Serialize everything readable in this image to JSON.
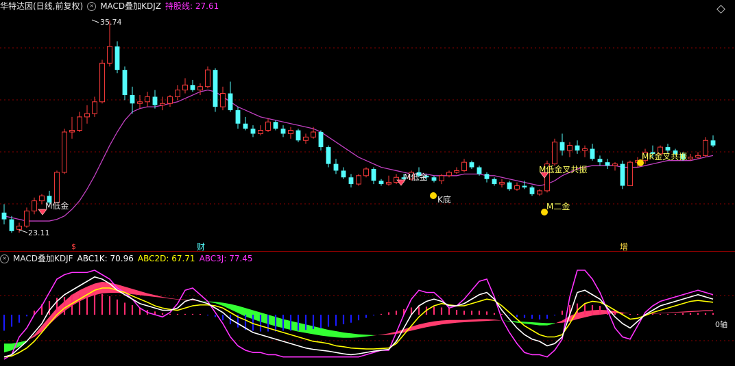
{
  "header_main": {
    "title": "华特达因(日线,前复权)",
    "indicator_name": "MACD叠加KDJZ",
    "hold_label": "持股线: 27.61",
    "colors": {
      "title": "#e6e6e6",
      "indicator": "#e6e6e6",
      "hold": "#ff33ff"
    }
  },
  "header_sub": {
    "indicator_name": "MACD叠加KDJF",
    "abc1k": "ABC1K: 70.96",
    "abc2d": "ABC2D: 67.71",
    "abc3j": "ABC3J: 77.45",
    "colors": {
      "abc1k": "#ffffff",
      "abc2d": "#ffff00",
      "abc3j": "#ff33ff"
    }
  },
  "annotations": {
    "high_price": "35.74",
    "low_price": "23.11",
    "m_low_gold_1": "M低金",
    "m_low_gold_2": "M低金",
    "k_bottom": "K底",
    "mk_resonance_1": "M低金叉共振",
    "m_second_gold": "M二金",
    "mk_resonance_2": "MK金叉共振",
    "marker_1": "$",
    "marker_2": "财",
    "marker_3": "增",
    "zero_axis": "0轴"
  },
  "colors": {
    "up": "#ff3c3c",
    "down": "#54fcfc",
    "ma": "#c040c0",
    "grid": "#8b0000",
    "k_line": "#ffffff",
    "d_line": "#ffff00",
    "j_line": "#ff33ff",
    "macd_pos": "#ff3c6e",
    "macd_neg": "#33ff33",
    "hist_neg": "#1a1aff"
  },
  "chart_data": {
    "type": "candlestick",
    "price_axis_range": [
      22,
      37
    ],
    "ohlc": [
      [
        24.3,
        24.8,
        23.6,
        23.9
      ],
      [
        23.9,
        24.1,
        23.1,
        23.2
      ],
      [
        23.3,
        23.7,
        23.1,
        23.5
      ],
      [
        23.5,
        24.6,
        23.4,
        24.4
      ],
      [
        24.4,
        25.2,
        24.2,
        25.0
      ],
      [
        25.0,
        25.4,
        24.8,
        25.3
      ],
      [
        25.3,
        25.6,
        24.8,
        24.9
      ],
      [
        24.9,
        26.8,
        24.9,
        26.7
      ],
      [
        26.7,
        29.3,
        26.6,
        29.1
      ],
      [
        29.1,
        30.0,
        28.7,
        29.2
      ],
      [
        29.2,
        30.3,
        29.1,
        30.0
      ],
      [
        30.0,
        30.7,
        29.6,
        30.2
      ],
      [
        30.2,
        31.2,
        30.0,
        30.9
      ],
      [
        30.9,
        33.4,
        30.8,
        33.2
      ],
      [
        33.2,
        35.74,
        33.0,
        34.2
      ],
      [
        34.2,
        34.5,
        32.6,
        32.8
      ],
      [
        32.8,
        33.0,
        31.0,
        31.3
      ],
      [
        31.3,
        31.8,
        30.2,
        30.8
      ],
      [
        30.8,
        31.3,
        30.5,
        30.9
      ],
      [
        30.9,
        31.5,
        30.6,
        31.2
      ],
      [
        31.2,
        31.6,
        30.5,
        30.7
      ],
      [
        30.7,
        31.2,
        30.4,
        30.8
      ],
      [
        30.8,
        31.3,
        30.6,
        31.2
      ],
      [
        31.2,
        31.9,
        31.0,
        31.6
      ],
      [
        31.6,
        32.3,
        31.4,
        31.9
      ],
      [
        31.9,
        32.2,
        31.5,
        31.6
      ],
      [
        31.6,
        32.0,
        31.3,
        31.8
      ],
      [
        31.8,
        33.0,
        31.7,
        32.8
      ],
      [
        32.8,
        32.9,
        30.3,
        30.6
      ],
      [
        30.6,
        31.8,
        30.4,
        31.4
      ],
      [
        31.4,
        32.1,
        30.3,
        30.4
      ],
      [
        30.4,
        30.6,
        29.3,
        29.6
      ],
      [
        29.6,
        30.0,
        29.2,
        29.3
      ],
      [
        29.3,
        29.5,
        28.8,
        29.0
      ],
      [
        29.0,
        29.5,
        28.9,
        29.2
      ],
      [
        29.2,
        29.9,
        29.1,
        29.7
      ],
      [
        29.7,
        29.8,
        29.2,
        29.3
      ],
      [
        29.3,
        29.5,
        28.8,
        29.0
      ],
      [
        29.0,
        29.4,
        28.7,
        29.2
      ],
      [
        29.2,
        29.3,
        28.5,
        28.6
      ],
      [
        28.6,
        29.0,
        28.4,
        28.8
      ],
      [
        28.8,
        29.4,
        28.7,
        29.1
      ],
      [
        29.1,
        29.2,
        28.0,
        28.2
      ],
      [
        28.2,
        28.3,
        27.0,
        27.2
      ],
      [
        27.2,
        27.5,
        26.6,
        26.8
      ],
      [
        26.8,
        27.0,
        26.3,
        26.4
      ],
      [
        26.4,
        26.6,
        25.8,
        26.0
      ],
      [
        26.0,
        26.6,
        25.9,
        26.5
      ],
      [
        26.5,
        27.0,
        26.4,
        26.9
      ],
      [
        26.9,
        27.0,
        26.0,
        26.2
      ],
      [
        26.2,
        26.3,
        25.9,
        26.0
      ],
      [
        26.0,
        26.5,
        25.9,
        26.1
      ],
      [
        26.1,
        26.6,
        26.0,
        26.4
      ],
      [
        26.4,
        26.6,
        26.1,
        26.3
      ],
      [
        26.3,
        26.8,
        26.2,
        26.7
      ],
      [
        26.7,
        27.0,
        26.4,
        26.5
      ],
      [
        26.5,
        26.6,
        26.2,
        26.4
      ],
      [
        26.4,
        26.5,
        26.1,
        26.2
      ],
      [
        26.2,
        26.6,
        26.0,
        26.5
      ],
      [
        26.5,
        26.8,
        26.4,
        26.7
      ],
      [
        26.7,
        27.0,
        26.6,
        26.8
      ],
      [
        26.8,
        27.5,
        26.7,
        27.3
      ],
      [
        27.3,
        27.4,
        26.9,
        27.0
      ],
      [
        27.0,
        27.1,
        26.5,
        26.6
      ],
      [
        26.6,
        26.7,
        26.1,
        26.3
      ],
      [
        26.3,
        26.4,
        25.9,
        26.0
      ],
      [
        26.0,
        26.3,
        25.8,
        26.1
      ],
      [
        26.1,
        26.2,
        25.6,
        25.7
      ],
      [
        25.7,
        26.1,
        25.6,
        25.9
      ],
      [
        25.9,
        26.2,
        25.7,
        25.8
      ],
      [
        25.8,
        25.9,
        25.3,
        25.4
      ],
      [
        25.4,
        25.7,
        25.3,
        25.6
      ],
      [
        25.6,
        27.4,
        25.5,
        27.2
      ],
      [
        27.2,
        28.7,
        27.1,
        28.5
      ],
      [
        28.5,
        29.0,
        27.7,
        28.0
      ],
      [
        28.0,
        28.5,
        27.6,
        28.3
      ],
      [
        28.3,
        28.6,
        27.8,
        28.0
      ],
      [
        28.0,
        28.3,
        27.6,
        28.1
      ],
      [
        28.1,
        28.4,
        27.4,
        27.5
      ],
      [
        27.5,
        27.7,
        27.1,
        27.3
      ],
      [
        27.3,
        27.5,
        26.9,
        27.1
      ],
      [
        27.1,
        27.3,
        26.8,
        27.2
      ],
      [
        27.2,
        27.4,
        25.7,
        25.9
      ],
      [
        25.9,
        27.4,
        25.9,
        27.3
      ],
      [
        27.3,
        27.6,
        27.0,
        27.4
      ],
      [
        27.4,
        28.1,
        27.2,
        27.9
      ],
      [
        27.9,
        28.3,
        27.6,
        27.8
      ],
      [
        27.8,
        28.3,
        27.7,
        28.2
      ],
      [
        28.2,
        28.4,
        27.8,
        28.0
      ],
      [
        28.0,
        28.1,
        27.7,
        27.8
      ],
      [
        27.8,
        27.9,
        27.4,
        27.5
      ],
      [
        27.5,
        27.8,
        27.4,
        27.6
      ],
      [
        27.6,
        27.9,
        27.5,
        27.7
      ],
      [
        27.7,
        28.8,
        27.6,
        28.6
      ],
      [
        28.6,
        28.9,
        28.2,
        28.3
      ]
    ],
    "ma_holding_line": [
      24.1,
      24.0,
      23.9,
      23.8,
      23.8,
      23.8,
      23.8,
      23.9,
      24.1,
      24.5,
      25.0,
      25.7,
      26.5,
      27.4,
      28.3,
      29.1,
      29.8,
      30.3,
      30.5,
      30.6,
      30.6,
      30.7,
      30.8,
      30.9,
      31.1,
      31.3,
      31.5,
      31.6,
      31.5,
      31.2,
      30.9,
      30.6,
      30.4,
      30.2,
      30.0,
      29.9,
      29.8,
      29.7,
      29.6,
      29.5,
      29.4,
      29.3,
      29.1,
      28.8,
      28.5,
      28.2,
      27.9,
      27.6,
      27.4,
      27.2,
      27.0,
      26.9,
      26.8,
      26.7,
      26.6,
      26.6,
      26.6,
      26.5,
      26.5,
      26.5,
      26.5,
      26.6,
      26.6,
      26.6,
      26.5,
      26.5,
      26.4,
      26.3,
      26.2,
      26.1,
      26.0,
      25.9,
      26.0,
      26.2,
      26.5,
      26.7,
      26.9,
      27.0,
      27.1,
      27.1,
      27.1,
      27.1,
      27.0,
      27.0,
      27.0,
      27.1,
      27.2,
      27.3,
      27.4,
      27.4,
      27.4,
      27.4,
      27.5,
      27.61,
      27.7
    ],
    "macd_axis_range": [
      -1,
      1
    ],
    "k_values": [
      -0.95,
      -0.9,
      -0.75,
      -0.6,
      -0.4,
      -0.2,
      0.1,
      0.3,
      0.45,
      0.55,
      0.65,
      0.75,
      0.85,
      0.8,
      0.7,
      0.55,
      0.45,
      0.35,
      0.25,
      0.2,
      0.15,
      0.1,
      0.1,
      0.15,
      0.3,
      0.35,
      0.3,
      0.25,
      0.15,
      0.05,
      -0.1,
      -0.2,
      -0.3,
      -0.4,
      -0.45,
      -0.5,
      -0.55,
      -0.6,
      -0.65,
      -0.7,
      -0.75,
      -0.78,
      -0.8,
      -0.82,
      -0.85,
      -0.88,
      -0.9,
      -0.88,
      -0.85,
      -0.82,
      -0.8,
      -0.78,
      -0.6,
      -0.3,
      0.0,
      0.2,
      0.3,
      0.35,
      0.3,
      0.2,
      0.2,
      0.25,
      0.35,
      0.45,
      0.5,
      0.35,
      0.1,
      -0.1,
      -0.3,
      -0.45,
      -0.55,
      -0.6,
      -0.7,
      -0.65,
      -0.5,
      0.0,
      0.5,
      0.55,
      0.45,
      0.35,
      0.15,
      -0.05,
      -0.2,
      -0.3,
      -0.15,
      0.0,
      0.1,
      0.2,
      0.25,
      0.3,
      0.35,
      0.4,
      0.45,
      0.4,
      0.35
    ],
    "d_values": [
      -0.95,
      -0.93,
      -0.85,
      -0.75,
      -0.6,
      -0.4,
      -0.2,
      0.0,
      0.15,
      0.25,
      0.35,
      0.45,
      0.55,
      0.6,
      0.6,
      0.55,
      0.5,
      0.42,
      0.35,
      0.28,
      0.2,
      0.15,
      0.12,
      0.1,
      0.15,
      0.2,
      0.22,
      0.22,
      0.2,
      0.15,
      0.05,
      -0.05,
      -0.12,
      -0.2,
      -0.25,
      -0.3,
      -0.35,
      -0.4,
      -0.45,
      -0.5,
      -0.55,
      -0.6,
      -0.62,
      -0.65,
      -0.7,
      -0.72,
      -0.75,
      -0.76,
      -0.77,
      -0.77,
      -0.76,
      -0.75,
      -0.65,
      -0.45,
      -0.25,
      -0.05,
      0.1,
      0.2,
      0.25,
      0.22,
      0.2,
      0.2,
      0.25,
      0.3,
      0.35,
      0.32,
      0.2,
      0.05,
      -0.1,
      -0.25,
      -0.35,
      -0.45,
      -0.5,
      -0.5,
      -0.45,
      -0.2,
      0.1,
      0.25,
      0.3,
      0.28,
      0.2,
      0.1,
      0.0,
      -0.1,
      -0.08,
      -0.02,
      0.05,
      0.1,
      0.15,
      0.2,
      0.25,
      0.3,
      0.32,
      0.3,
      0.28
    ],
    "j_values": [
      -1.0,
      -0.9,
      -0.5,
      -0.3,
      0.0,
      0.2,
      0.5,
      0.8,
      0.9,
      0.95,
      0.95,
      0.95,
      1.0,
      0.9,
      0.8,
      0.6,
      0.5,
      0.35,
      0.15,
      0.05,
      0.0,
      -0.05,
      0.05,
      0.25,
      0.55,
      0.6,
      0.45,
      0.3,
      0.05,
      -0.2,
      -0.5,
      -0.7,
      -0.8,
      -0.85,
      -0.85,
      -0.9,
      -0.9,
      -0.95,
      -0.95,
      -0.95,
      -0.95,
      -0.95,
      -0.95,
      -0.95,
      -0.95,
      -0.95,
      -0.95,
      -0.95,
      -0.9,
      -0.85,
      -0.8,
      -0.8,
      -0.4,
      0.0,
      0.35,
      0.55,
      0.5,
      0.5,
      0.35,
      0.15,
      0.2,
      0.35,
      0.55,
      0.75,
      0.8,
      0.4,
      -0.1,
      -0.4,
      -0.65,
      -0.85,
      -0.9,
      -0.9,
      -0.95,
      -0.8,
      -0.55,
      0.4,
      1.0,
      1.0,
      0.8,
      0.5,
      0.1,
      -0.3,
      -0.5,
      -0.55,
      -0.25,
      0.05,
      0.2,
      0.3,
      0.35,
      0.4,
      0.45,
      0.5,
      0.55,
      0.5,
      0.45
    ],
    "macd_values": [
      -0.85,
      -0.8,
      -0.72,
      -0.6,
      -0.45,
      -0.25,
      -0.05,
      0.15,
      0.3,
      0.45,
      0.55,
      0.63,
      0.7,
      0.74,
      0.72,
      0.68,
      0.63,
      0.58,
      0.53,
      0.48,
      0.44,
      0.4,
      0.37,
      0.35,
      0.34,
      0.33,
      0.31,
      0.29,
      0.26,
      0.2,
      0.12,
      0.04,
      -0.04,
      -0.1,
      -0.16,
      -0.21,
      -0.26,
      -0.3,
      -0.34,
      -0.38,
      -0.41,
      -0.44,
      -0.47,
      -0.49,
      -0.51,
      -0.52,
      -0.52,
      -0.51,
      -0.49,
      -0.47,
      -0.45,
      -0.42,
      -0.38,
      -0.33,
      -0.27,
      -0.22,
      -0.18,
      -0.15,
      -0.13,
      -0.12,
      -0.12,
      -0.12,
      -0.11,
      -0.1,
      -0.1,
      -0.11,
      -0.13,
      -0.15,
      -0.18,
      -0.2,
      -0.22,
      -0.24,
      -0.24,
      -0.2,
      -0.13,
      -0.03,
      0.04,
      0.08,
      0.1,
      0.11,
      0.1,
      0.08,
      0.05,
      0.03,
      0.02,
      0.02,
      0.03,
      0.04,
      0.05,
      0.06,
      0.07,
      0.08,
      0.09,
      0.1,
      0.1
    ],
    "signal_values": [
      -0.65,
      -0.65,
      -0.62,
      -0.58,
      -0.5,
      -0.38,
      -0.22,
      -0.06,
      0.08,
      0.2,
      0.3,
      0.38,
      0.44,
      0.48,
      0.49,
      0.49,
      0.48,
      0.46,
      0.44,
      0.42,
      0.4,
      0.38,
      0.36,
      0.34,
      0.33,
      0.32,
      0.31,
      0.3,
      0.29,
      0.27,
      0.24,
      0.2,
      0.15,
      0.1,
      0.05,
      0.0,
      -0.05,
      -0.1,
      -0.14,
      -0.18,
      -0.22,
      -0.26,
      -0.3,
      -0.34,
      -0.37,
      -0.4,
      -0.42,
      -0.44,
      -0.45,
      -0.46,
      -0.46,
      -0.45,
      -0.43,
      -0.4,
      -0.36,
      -0.32,
      -0.28,
      -0.25,
      -0.22,
      -0.2,
      -0.18,
      -0.17,
      -0.16,
      -0.15,
      -0.14,
      -0.13,
      -0.13,
      -0.14,
      -0.15,
      -0.16,
      -0.17,
      -0.18,
      -0.19,
      -0.19,
      -0.18,
      -0.15,
      -0.1,
      -0.06,
      -0.02,
      0.0,
      0.02,
      0.03,
      0.03,
      0.03,
      0.02,
      0.02,
      0.02,
      0.03,
      0.04,
      0.05,
      0.05,
      0.06,
      0.07,
      0.08,
      0.08
    ]
  }
}
